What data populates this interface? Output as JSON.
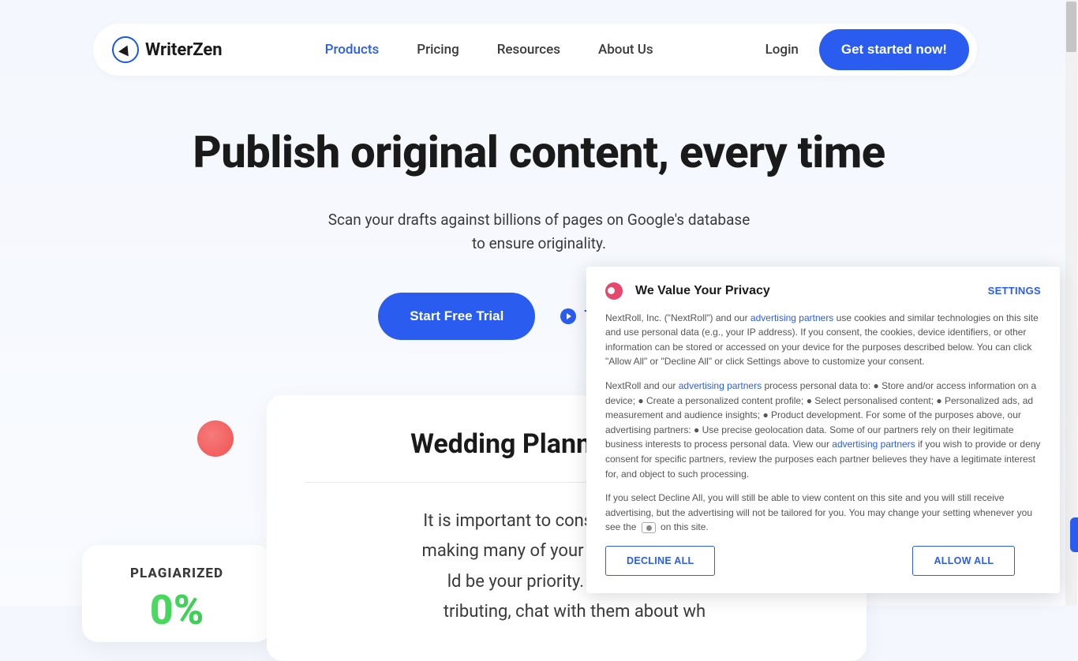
{
  "brand": "WriterZen",
  "nav": {
    "items": [
      {
        "label": "Products",
        "active": true
      },
      {
        "label": "Pricing",
        "active": false
      },
      {
        "label": "Resources",
        "active": false
      },
      {
        "label": "About Us",
        "active": false
      }
    ],
    "login": "Login",
    "cta": "Get started now!"
  },
  "hero": {
    "title": "Publish original content, every time",
    "sub_line1": "Scan your drafts against billions of pages on Google's database",
    "sub_line2": "to ensure originality.",
    "trial_label": "Start Free Trial",
    "tour_label": "Take A Quick Tour"
  },
  "plagiarism": {
    "label": "PLAGIARIZED",
    "percent": "0%"
  },
  "demo": {
    "title": "Wedding Planner: The Ulti",
    "body_line1": "It is important to consider your weddi",
    "body_line2": "making many of your wedding-related",
    "body_line3": "ld be your priority. If any family m",
    "body_line4": "tributing, chat with them about wh"
  },
  "cookie": {
    "title": "We Value Your Privacy",
    "settings": "SETTINGS",
    "p1_a": "NextRoll, Inc. (\"NextRoll\") and our ",
    "adv_link": "advertising partners",
    "p1_b": " use cookies and similar technologies on this site and use personal data (e.g., your IP address). If you consent, the cookies, device identifiers, or other information can be stored or accessed on your device for the purposes described below. You can click \"Allow All\" or \"Decline All\" or click Settings above to customize your consent.",
    "p2_a": "NextRoll and our ",
    "p2_b": " process personal data to: ● Store and/or access information on a device; ● Create a personalized content profile; ● Select personalised content; ● Personalized ads, ad measurement and audience insights; ● Product development. For some of the purposes above, our advertising partners: ● Use precise geolocation data. Some of our partners rely on their legitimate business interests to process personal data. View our ",
    "p2_c": " if you wish to provide or deny consent for specific partners, review the purposes each partner believes they have a legitimate interest for, and object to such processing.",
    "p3_a": "If you select Decline All, you will still be able to view content on this site and you will still receive advertising, but the advertising will not be tailored for you. You may change your setting whenever you see the ",
    "p3_b": " on this site.",
    "decline": "DECLINE ALL",
    "allow": "ALLOW ALL"
  },
  "colors": {
    "accent": "#2a5cf0",
    "bg": "#f4f7fd"
  }
}
